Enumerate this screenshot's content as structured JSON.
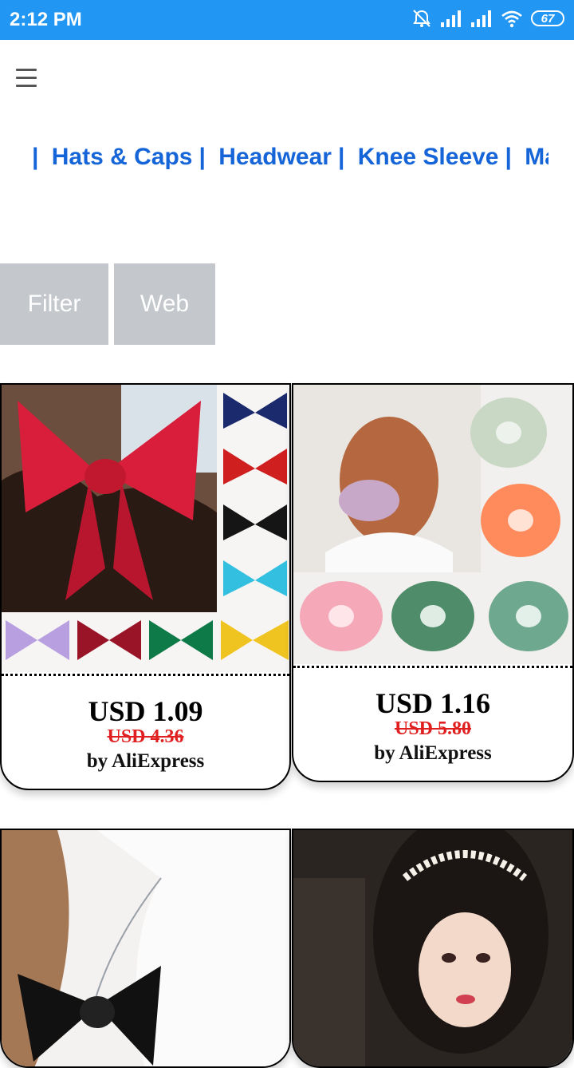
{
  "status_bar": {
    "time": "2:12 PM",
    "battery": "67",
    "icons": [
      "alarm-off-icon",
      "signal-icon",
      "signal-icon",
      "wifi-icon",
      "battery-icon"
    ]
  },
  "header": {
    "menu_icon": "hamburger-menu-icon"
  },
  "categories": {
    "separator": "|",
    "items": [
      "Hats & Caps",
      "Headwear",
      "Knee Sleeve",
      "Ma"
    ]
  },
  "actions": {
    "filter_label": "Filter",
    "web_label": "Web"
  },
  "products": [
    {
      "price": "USD 1.09",
      "old_price": "USD 4.36",
      "seller": "by AliExpress",
      "image": "bow-hair-clips-image"
    },
    {
      "price": "USD 1.16",
      "old_price": "USD 5.80",
      "seller": "by AliExpress",
      "image": "organza-scrunchies-image"
    },
    {
      "image": "black-bow-braid-image"
    },
    {
      "image": "pearl-headband-image"
    }
  ]
}
